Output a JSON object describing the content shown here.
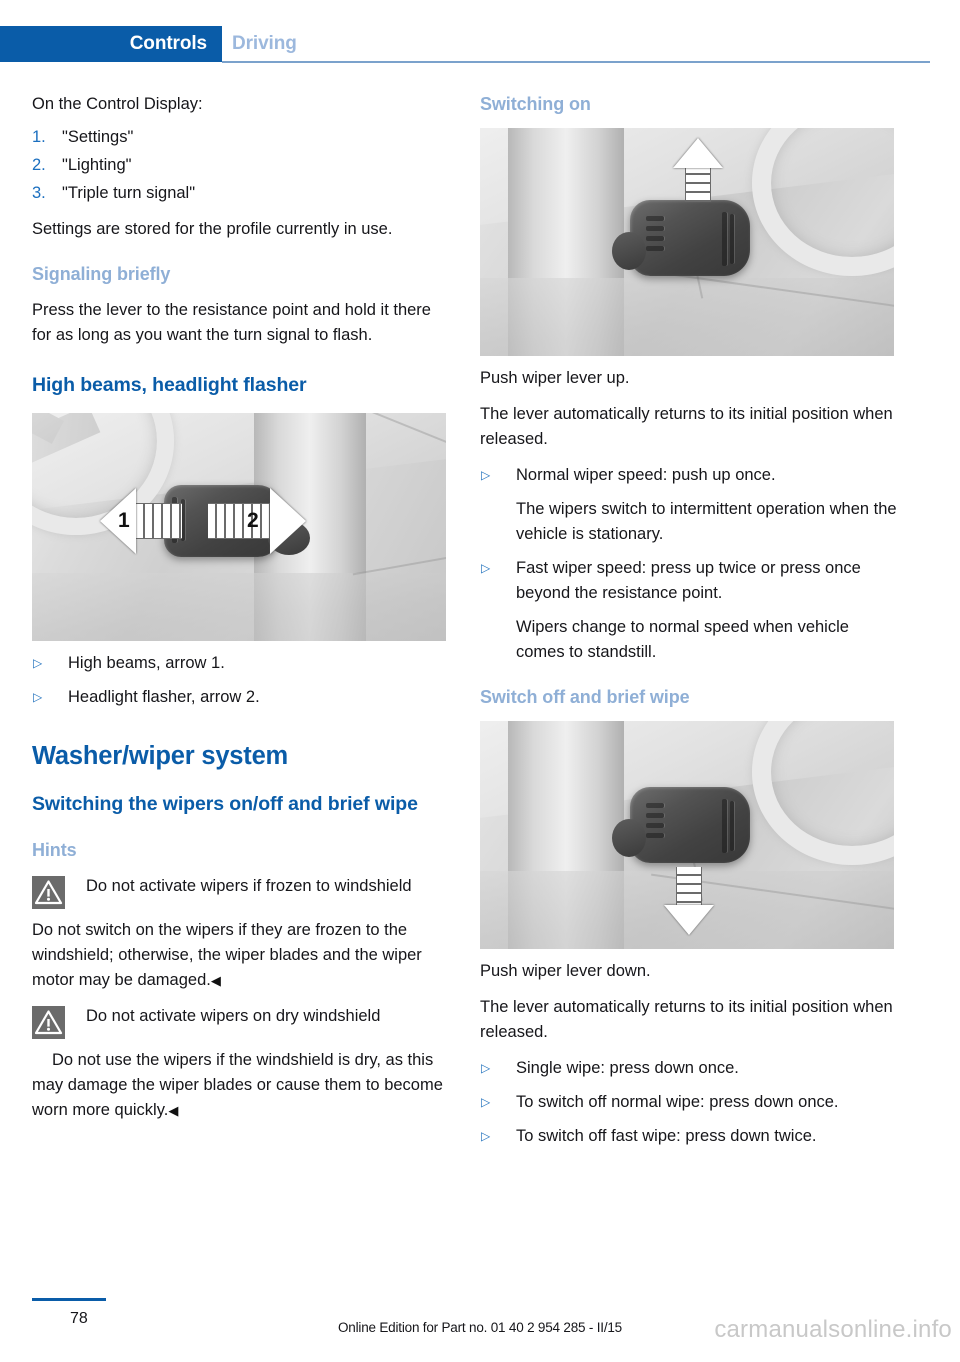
{
  "header": {
    "active_tab": "Controls",
    "inactive_tab": "Driving",
    "accent_color": "#0a5ca8",
    "inactive_color": "#9cb8dd"
  },
  "left_column": {
    "intro": "On the Control Display:",
    "numbered_list": [
      {
        "num": "1.",
        "text": "\"Settings\""
      },
      {
        "num": "2.",
        "text": "\"Lighting\""
      },
      {
        "num": "3.",
        "text": "\"Triple turn signal\""
      }
    ],
    "after_list": "Settings are stored for the profile currently in use.",
    "signaling_heading": "Signaling briefly",
    "signaling_body": "Press the lever to the resistance point and hold it there for as long as you want the turn signal to flash.",
    "highbeams_heading": "High beams, headlight flasher",
    "highbeams_figure": {
      "alt": "Steering column lever with arrow 1 pointing left and arrow 2 pointing right",
      "label_1": "1",
      "label_2": "2"
    },
    "highbeams_bullets": [
      "High beams, arrow 1.",
      "Headlight flasher, arrow 2."
    ],
    "washer_heading": "Washer/wiper system",
    "washer_sub_heading": "Switching the wipers on/off and brief wipe",
    "hints_heading": "Hints",
    "note_1": {
      "icon": "warning-triangle-icon",
      "title": "Do not activate wipers if frozen to windshield",
      "body": "Do not switch on the wipers if they are frozen to the windshield; otherwise, the wiper blades and the wiper motor may be damaged.",
      "endmark": "◀"
    },
    "note_2": {
      "icon": "warning-triangle-icon",
      "title": "Do not activate wipers on dry windshield",
      "body": "Do not use the wipers if the windshield is dry, as this may damage the wiper blades or cause them to become worn more quickly.",
      "endmark": "◀"
    }
  },
  "right_column": {
    "switching_on_heading": "Switching on",
    "switching_on_figure": {
      "alt": "Wiper lever on steering column with white arrow pointing up"
    },
    "push_up": "Push wiper lever up.",
    "returns_1": "The lever automatically returns to its initial position when released.",
    "up_bullets": [
      {
        "text": "Normal wiper speed: push up once.",
        "continuation": "The wipers switch to intermittent operation when the vehicle is stationary."
      },
      {
        "text": "Fast wiper speed: press up twice or press once beyond the resistance point.",
        "continuation": "Wipers change to normal speed when vehicle comes to standstill."
      }
    ],
    "switch_off_heading": "Switch off and brief wipe",
    "switch_off_figure": {
      "alt": "Wiper lever on steering column with white arrow pointing down"
    },
    "push_down": "Push wiper lever down.",
    "returns_2": "The lever automatically returns to its initial position when released.",
    "down_bullets": [
      "Single wipe: press down once.",
      "To switch off normal wipe: press down once.",
      "To switch off fast wipe: press down twice."
    ]
  },
  "footer": {
    "page_number": "78",
    "edition_text": "Online Edition for Part no. 01 40 2 954 285 - II/15",
    "watermark": "carmanualsonline.info"
  }
}
